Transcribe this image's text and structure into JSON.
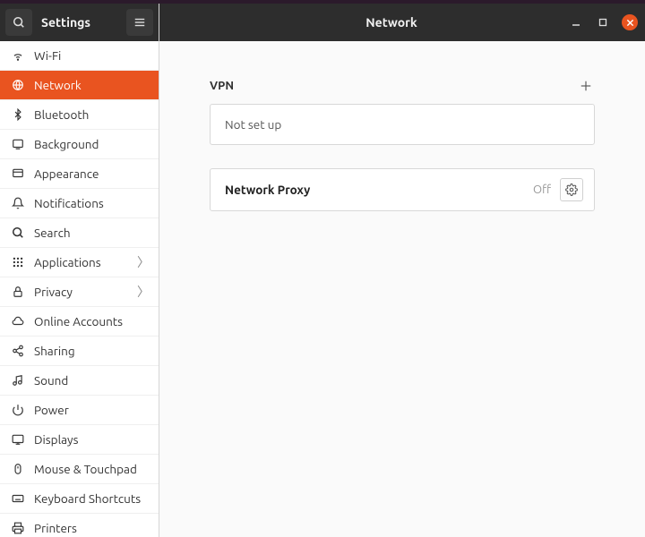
{
  "sidebar": {
    "title": "Settings",
    "items": [
      {
        "label": "Wi-Fi"
      },
      {
        "label": "Network"
      },
      {
        "label": "Bluetooth"
      },
      {
        "label": "Background"
      },
      {
        "label": "Appearance"
      },
      {
        "label": "Notifications"
      },
      {
        "label": "Search"
      },
      {
        "label": "Applications",
        "expandable": true
      },
      {
        "label": "Privacy",
        "expandable": true
      },
      {
        "label": "Online Accounts"
      },
      {
        "label": "Sharing"
      },
      {
        "label": "Sound"
      },
      {
        "label": "Power"
      },
      {
        "label": "Displays"
      },
      {
        "label": "Mouse & Touchpad"
      },
      {
        "label": "Keyboard Shortcuts"
      },
      {
        "label": "Printers"
      }
    ],
    "active_index": 1
  },
  "titlebar": {
    "title": "Network"
  },
  "main": {
    "vpn": {
      "heading": "VPN",
      "status": "Not set up"
    },
    "proxy": {
      "label": "Network Proxy",
      "status": "Off"
    }
  },
  "colors": {
    "accent": "#e95420"
  }
}
